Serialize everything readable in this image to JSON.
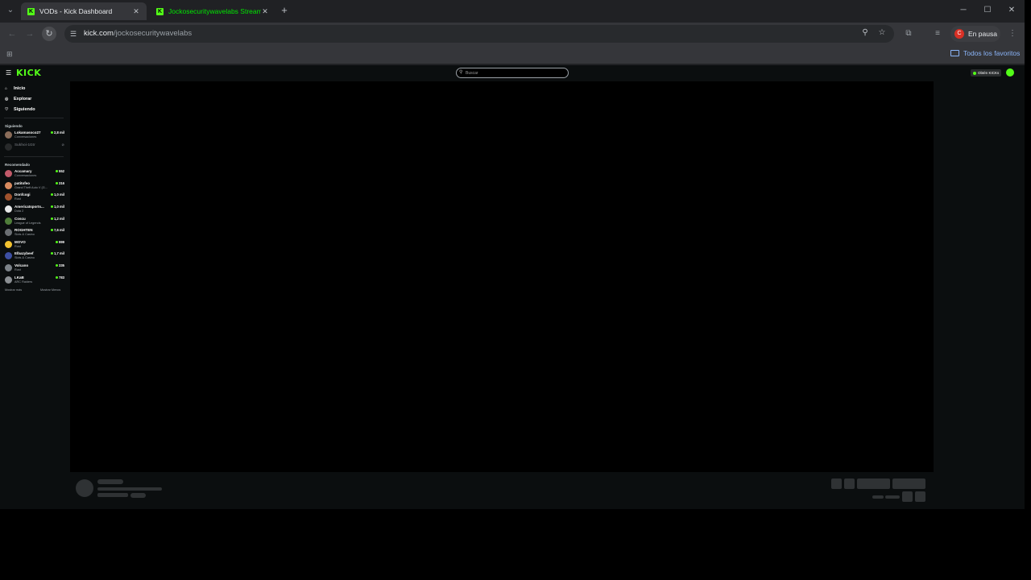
{
  "browser": {
    "tabs": [
      {
        "title": "VODs - Kick Dashboard",
        "active": true
      },
      {
        "title": "Jockosecuritywavelabs Stream",
        "active": false
      }
    ],
    "new_tab": "+",
    "window_controls": {
      "minimize": "─",
      "maximize": "☐",
      "close": "✕"
    },
    "address": {
      "host": "kick.com",
      "path": "/jockosecuritywavelabs"
    },
    "profile_label": "En pausa",
    "profile_initial": "C",
    "favorites_label": "Todos los favoritos"
  },
  "kick": {
    "logo": "KICK",
    "search_placeholder": "Buscar",
    "header_button": "Obtén KICKs",
    "nav": [
      {
        "icon": "home-icon",
        "glyph": "⌂",
        "label": "Inicio"
      },
      {
        "icon": "compass-icon",
        "glyph": "◎",
        "label": "Explorar"
      },
      {
        "icon": "heart-icon",
        "glyph": "♡",
        "label": "Siguiendo"
      }
    ],
    "following_title": "Siguiendo",
    "following": [
      {
        "name": "Lokamasoco27",
        "category": "Conversaciones",
        "viewers": "2,8 mil",
        "live": true,
        "color": "#8a6d5a"
      },
      {
        "name": "Sukhoi-1Gtr",
        "category": "",
        "viewers": "",
        "live": false,
        "color": "#555"
      }
    ],
    "recommended_title": "Recomendado",
    "recommended": [
      {
        "name": "Accamary",
        "category": "Conversaciones",
        "viewers": "552",
        "color": "#c25a6a"
      },
      {
        "name": "patitofeo",
        "category": "Grand Theft Auto V (G...",
        "viewers": "316",
        "color": "#d98b5f"
      },
      {
        "name": "Donfcogi",
        "category": "Rust",
        "viewers": "1,0 mil",
        "color": "#a0522d"
      },
      {
        "name": "Americatsports...",
        "category": "Dota 2",
        "viewers": "1,0 mil",
        "color": "#e8e8e8"
      },
      {
        "name": "Coscu",
        "category": "League of Legends",
        "viewers": "1,2 mil",
        "color": "#4f7d3a"
      },
      {
        "name": "ROGHTEN",
        "category": "Slots & Casino",
        "viewers": "7,6 mil",
        "color": "#6b6f73"
      },
      {
        "name": "MOVO",
        "category": "Rust",
        "viewers": "999",
        "color": "#f2c230"
      },
      {
        "name": "Elbazybeef",
        "category": "Slots & Casino",
        "viewers": "1,7 mil",
        "color": "#3d4fa3"
      },
      {
        "name": "Volcano",
        "category": "Rust",
        "viewers": "335",
        "color": "#7c8288"
      },
      {
        "name": "LKaB",
        "category": "ARC Raiders",
        "viewers": "783",
        "color": "#8b8f93"
      }
    ],
    "show_more": "Mostrar más",
    "show_less": "Mostrar Menos"
  }
}
